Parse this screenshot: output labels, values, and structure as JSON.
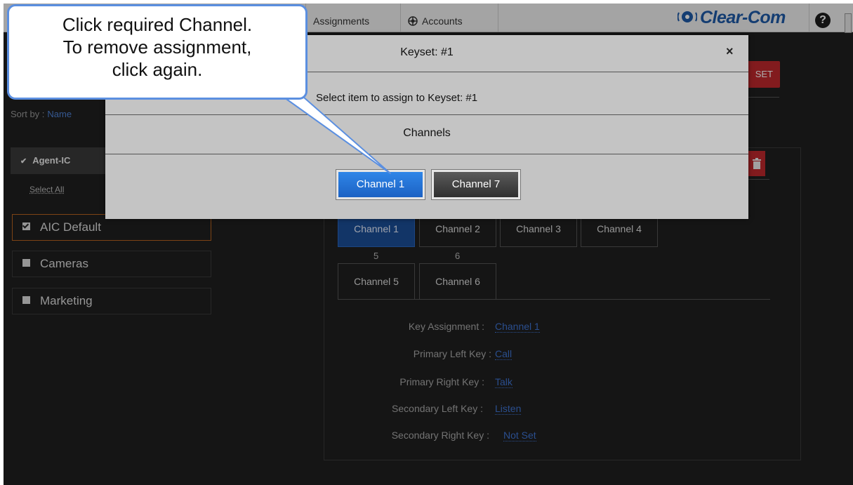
{
  "nav": {
    "tabs": [
      {
        "label": "Assignments",
        "icon": "assignments-icon"
      },
      {
        "label": "Accounts",
        "icon": "accounts-icon"
      }
    ],
    "brand": "Clear-Com",
    "help_label": "?"
  },
  "toolbar": {
    "reset_label": "SET"
  },
  "sort": {
    "label": "Sort by :",
    "value": "Name"
  },
  "group": {
    "name": "Agent-IC",
    "select_all": "Select All"
  },
  "profiles": [
    {
      "label": "AIC Default",
      "checked": true
    },
    {
      "label": "Cameras",
      "checked": false
    },
    {
      "label": "Marketing",
      "checked": false
    }
  ],
  "channels": {
    "row1": [
      "Channel 1",
      "Channel 2",
      "Channel 3",
      "Channel 4"
    ],
    "row2_numbers": [
      "5",
      "6"
    ],
    "row2": [
      "Channel 5",
      "Channel 6"
    ],
    "selected": "Channel 1"
  },
  "details": [
    {
      "label": "Key Assignment :",
      "value": "Channel 1"
    },
    {
      "label": "Primary Left Key :",
      "value": "Call"
    },
    {
      "label": "Primary Right Key :",
      "value": "Talk"
    },
    {
      "label": "Secondary Left Key :",
      "value": "Listen"
    },
    {
      "label": "Secondary Right Key :",
      "value": "Not Set"
    }
  ],
  "modal": {
    "title": "Keyset: #1",
    "close": "×",
    "subtitle": "Select item to assign to Keyset: #1",
    "section": "Channels",
    "options": [
      "Channel 1",
      "Channel 7"
    ]
  },
  "callout": {
    "lines": [
      "Click required Channel.",
      "To remove assignment,",
      "click again."
    ]
  },
  "colors": {
    "accent_blue": "#1c62c4",
    "danger_red": "#c0282d",
    "selection_orange": "#b9631f",
    "link_blue": "#3f74d2"
  }
}
